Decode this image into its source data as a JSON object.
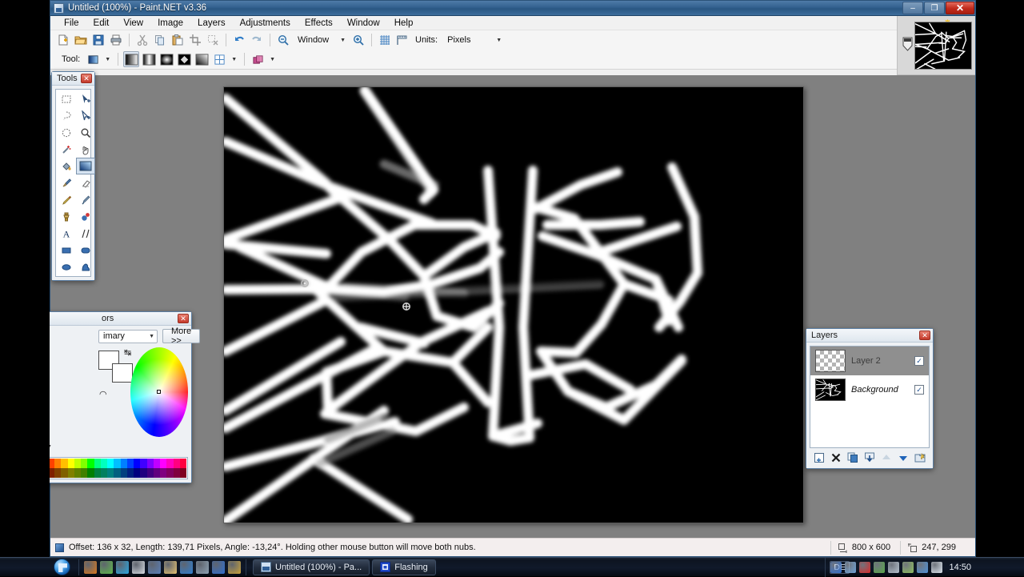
{
  "window": {
    "title": "Untitled (100%) - Paint.NET v3.36",
    "icon": "paintnet-icon",
    "minimize_label": "–",
    "restore_label": "❐",
    "close_label": "✕"
  },
  "menubar": {
    "items": [
      {
        "label": "File"
      },
      {
        "label": "Edit"
      },
      {
        "label": "View"
      },
      {
        "label": "Image"
      },
      {
        "label": "Layers"
      },
      {
        "label": "Adjustments"
      },
      {
        "label": "Effects"
      },
      {
        "label": "Window"
      },
      {
        "label": "Help"
      }
    ]
  },
  "toolbar": {
    "buttons": [
      {
        "name": "new-icon",
        "title": "New"
      },
      {
        "name": "open-icon",
        "title": "Open"
      },
      {
        "name": "save-icon",
        "title": "Save"
      },
      {
        "name": "print-icon",
        "title": "Print"
      },
      {
        "name": "cut-icon",
        "title": "Cut"
      },
      {
        "name": "copy-icon",
        "title": "Copy"
      },
      {
        "name": "paste-icon",
        "title": "Paste"
      },
      {
        "name": "crop-icon",
        "title": "Crop to Selection"
      },
      {
        "name": "deselect-icon",
        "title": "Deselect All"
      },
      {
        "name": "undo-icon",
        "title": "Undo"
      },
      {
        "name": "redo-icon",
        "title": "Redo"
      }
    ],
    "zoom_out_icon": "zoom-out-icon",
    "zoom_in_icon": "zoom-in-icon",
    "zoom_value": "Window",
    "grid_icon": "grid-icon",
    "rulers_icon": "rulers-icon",
    "units_label": "Units:",
    "units_value": "Pixels"
  },
  "tooloptions": {
    "tool_label": "Tool:",
    "tool_icon": "gradient-tool-icon",
    "gradient_types": [
      {
        "name": "gradient-linear-icon",
        "selected": true
      },
      {
        "name": "gradient-linear-reflected-icon",
        "selected": false
      },
      {
        "name": "gradient-radial-icon",
        "selected": false
      },
      {
        "name": "gradient-diamond-icon",
        "selected": false
      },
      {
        "name": "gradient-conical-icon",
        "selected": false
      }
    ],
    "channel_icon": "gradient-channel-icon",
    "blend_icon": "blend-mode-icon"
  },
  "tools": {
    "title": "Tools",
    "close_label": "✕",
    "items": [
      {
        "name": "rectangle-select-icon",
        "label": "Rectangle Select",
        "selected": false
      },
      {
        "name": "move-selected-icon",
        "label": "Move Selected",
        "selected": false
      },
      {
        "name": "lasso-select-icon",
        "label": "Lasso Select",
        "selected": false
      },
      {
        "name": "move-selection-icon",
        "label": "Move Selection",
        "selected": false
      },
      {
        "name": "ellipse-select-icon",
        "label": "Ellipse Select",
        "selected": false
      },
      {
        "name": "zoom-icon",
        "label": "Zoom",
        "selected": false
      },
      {
        "name": "magic-wand-icon",
        "label": "Magic Wand",
        "selected": false
      },
      {
        "name": "pan-icon",
        "label": "Pan",
        "selected": false
      },
      {
        "name": "paint-bucket-icon",
        "label": "Paint Bucket",
        "selected": false
      },
      {
        "name": "gradient-icon",
        "label": "Gradient",
        "selected": true
      },
      {
        "name": "paintbrush-icon",
        "label": "Paintbrush",
        "selected": false
      },
      {
        "name": "eraser-icon",
        "label": "Eraser",
        "selected": false
      },
      {
        "name": "pencil-icon",
        "label": "Pencil",
        "selected": false
      },
      {
        "name": "color-picker-icon",
        "label": "Color Picker",
        "selected": false
      },
      {
        "name": "clone-stamp-icon",
        "label": "Clone Stamp",
        "selected": false
      },
      {
        "name": "recolor-icon",
        "label": "Recolor",
        "selected": false
      },
      {
        "name": "text-icon",
        "label": "Text",
        "selected": false
      },
      {
        "name": "line-curve-icon",
        "label": "Line / Curve",
        "selected": false
      },
      {
        "name": "rectangle-icon",
        "label": "Rectangle",
        "selected": false
      },
      {
        "name": "rounded-rectangle-icon",
        "label": "Rounded Rectangle",
        "selected": false
      },
      {
        "name": "ellipse-icon",
        "label": "Ellipse",
        "selected": false
      },
      {
        "name": "freeform-shape-icon",
        "label": "Freeform Shape",
        "selected": false
      }
    ]
  },
  "colors": {
    "title": "Colors",
    "title_visible": "ors",
    "close_label": "✕",
    "mode_value": "imary",
    "more_label": "More >>",
    "primary_color": "#ffffff",
    "secondary_color": "#ffffff",
    "swap_icon": "swap-colors-icon",
    "reset_icon": "reset-colors-icon",
    "palette_icon": "palette-menu-icon",
    "swatches_bright": [
      "#000000",
      "#404040",
      "#ff0000",
      "#ff4000",
      "#ff8000",
      "#ffbf00",
      "#ffff00",
      "#bfff00",
      "#80ff00",
      "#00ff00",
      "#00ff80",
      "#00ffbf",
      "#00ffff",
      "#00bfff",
      "#0080ff",
      "#0040ff",
      "#0000ff",
      "#4000ff",
      "#8000ff",
      "#bf00ff",
      "#ff00ff",
      "#ff00bf",
      "#ff0080",
      "#ff0040"
    ],
    "swatches_dark": [
      "#808080",
      "#a0a0a0",
      "#800000",
      "#802000",
      "#804000",
      "#806000",
      "#808000",
      "#608000",
      "#408000",
      "#008000",
      "#008040",
      "#008060",
      "#008080",
      "#006080",
      "#004080",
      "#002080",
      "#000080",
      "#200080",
      "#400080",
      "#600080",
      "#800080",
      "#800060",
      "#800040",
      "#800020"
    ]
  },
  "layers": {
    "title": "Layers",
    "close_label": "✕",
    "items": [
      {
        "name": "Layer 2",
        "selected": true,
        "visible": true,
        "thumb": "checker",
        "italic": false
      },
      {
        "name": "Background",
        "selected": false,
        "visible": true,
        "thumb": "artwork",
        "italic": true
      }
    ],
    "check_glyph": "✓",
    "buttons": [
      {
        "name": "add-layer-icon",
        "label": "Add New Layer",
        "disabled": false
      },
      {
        "name": "delete-layer-icon",
        "label": "Delete Layer",
        "disabled": false
      },
      {
        "name": "duplicate-layer-icon",
        "label": "Duplicate Layer",
        "disabled": false
      },
      {
        "name": "merge-layer-down-icon",
        "label": "Merge Layer Down",
        "disabled": false
      },
      {
        "name": "move-layer-up-icon",
        "label": "Move Layer Up",
        "disabled": true
      },
      {
        "name": "move-layer-down-icon",
        "label": "Move Layer Down",
        "disabled": false
      },
      {
        "name": "layer-properties-icon",
        "label": "Layer Properties",
        "disabled": false
      }
    ]
  },
  "statusbar": {
    "icon": "gradient-status-icon",
    "message": "Offset: 136 x 32, Length: 139,71 Pixels, Angle: -13,24°. Holding other mouse button will move both nubs.",
    "size_icon": "image-size-icon",
    "size_value": "800 x 600",
    "cursor_icon": "cursor-position-icon",
    "cursor_value": "247, 299"
  },
  "taskbar": {
    "start_label": "Start",
    "quicklaunch": [
      {
        "name": "firefox-icon",
        "color": "#d9781f"
      },
      {
        "name": "antivirus-icon",
        "color": "#5fb84a"
      },
      {
        "name": "skype-icon",
        "color": "#2aa7e0"
      },
      {
        "name": "utorrent-icon",
        "color": "#d8dde4"
      },
      {
        "name": "media-player-icon",
        "color": "#5a7fb8"
      },
      {
        "name": "explorer-icon",
        "color": "#e5c271"
      },
      {
        "name": "ie-icon",
        "color": "#2f7fd1"
      },
      {
        "name": "steam-icon",
        "color": "#8fa3b5"
      },
      {
        "name": "paintnet-icon",
        "color": "#2f6fd0"
      },
      {
        "name": "game-icon",
        "color": "#c9a23a"
      }
    ],
    "tasks": [
      {
        "name": "taskbar-paintnet",
        "label": "Untitled (100%) - Pa...",
        "active": true
      },
      {
        "name": "taskbar-flashing",
        "label": "Flashing",
        "active": false
      }
    ],
    "language": "DE",
    "tray": [
      {
        "name": "tray-paintnet-icon",
        "color": "#2f6fd0"
      },
      {
        "name": "tray-network-share-icon",
        "color": "#6fa3d8"
      },
      {
        "name": "tray-avira-icon",
        "color": "#d82a2a"
      },
      {
        "name": "tray-shield-icon",
        "color": "#59a84a"
      },
      {
        "name": "tray-monitor-icon",
        "color": "#b6c2cf"
      },
      {
        "name": "tray-network-icon",
        "color": "#8fbf5f"
      },
      {
        "name": "tray-sync-icon",
        "color": "#4f92d8"
      },
      {
        "name": "tray-volume-icon",
        "color": "#dde6ef"
      }
    ],
    "clock": "14:50"
  },
  "thumbnail": {
    "name": "image-thumbnail",
    "star_glyph": "✸",
    "pin_name": "pin-icon"
  },
  "canvas": {
    "background": "#000000",
    "stroke_color": "#ffffff",
    "nub_start": "start-nub",
    "nub_end": "end-nub"
  }
}
